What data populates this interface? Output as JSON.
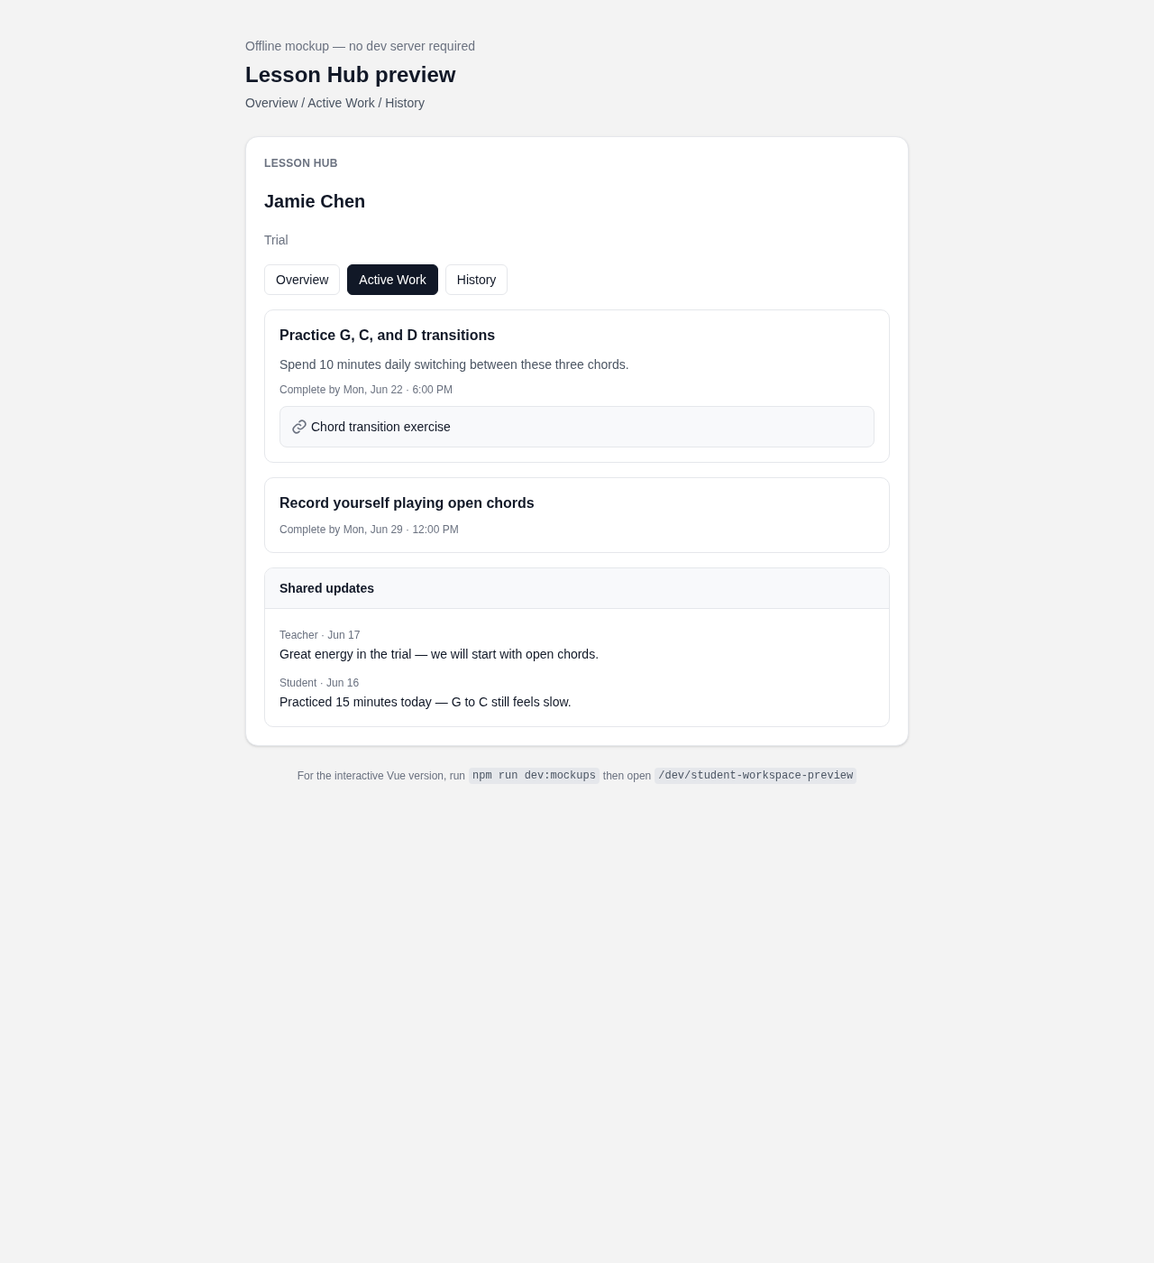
{
  "header": {
    "note": "Offline mockup — no dev server required",
    "title": "Lesson Hub preview",
    "breadcrumb": "Overview / Active Work / History"
  },
  "card": {
    "eyebrow": "LESSON HUB",
    "student": "Jamie Chen",
    "status": "Trial",
    "tabs": [
      {
        "label": "Overview",
        "selected": false
      },
      {
        "label": "Active Work",
        "selected": true
      },
      {
        "label": "History",
        "selected": false
      }
    ],
    "tasks": [
      {
        "title": "Practice G, C, and D transitions",
        "description": "Spend 10 minutes daily switching between these three chords.",
        "due": "Complete by Mon, Jun 22 · 6:00 PM",
        "resource": "Chord transition exercise"
      },
      {
        "title": "Record yourself playing open chords",
        "due": "Complete by Mon, Jun 29 · 12:00 PM"
      }
    ],
    "updates": {
      "title": "Shared updates",
      "items": [
        {
          "meta": "Teacher · Jun 17",
          "text": "Great energy in the trial — we will start with open chords."
        },
        {
          "meta": "Student · Jun 16",
          "text": "Practiced 15 minutes today — G to C still feels slow."
        }
      ]
    }
  },
  "footer": [
    {
      "kind": "text",
      "text": "For the interactive Vue version, run"
    },
    {
      "kind": "code",
      "text": "npm run dev:mockups"
    },
    {
      "kind": "text",
      "text": "then open"
    },
    {
      "kind": "code",
      "text": "/dev/student-workspace-preview"
    }
  ]
}
